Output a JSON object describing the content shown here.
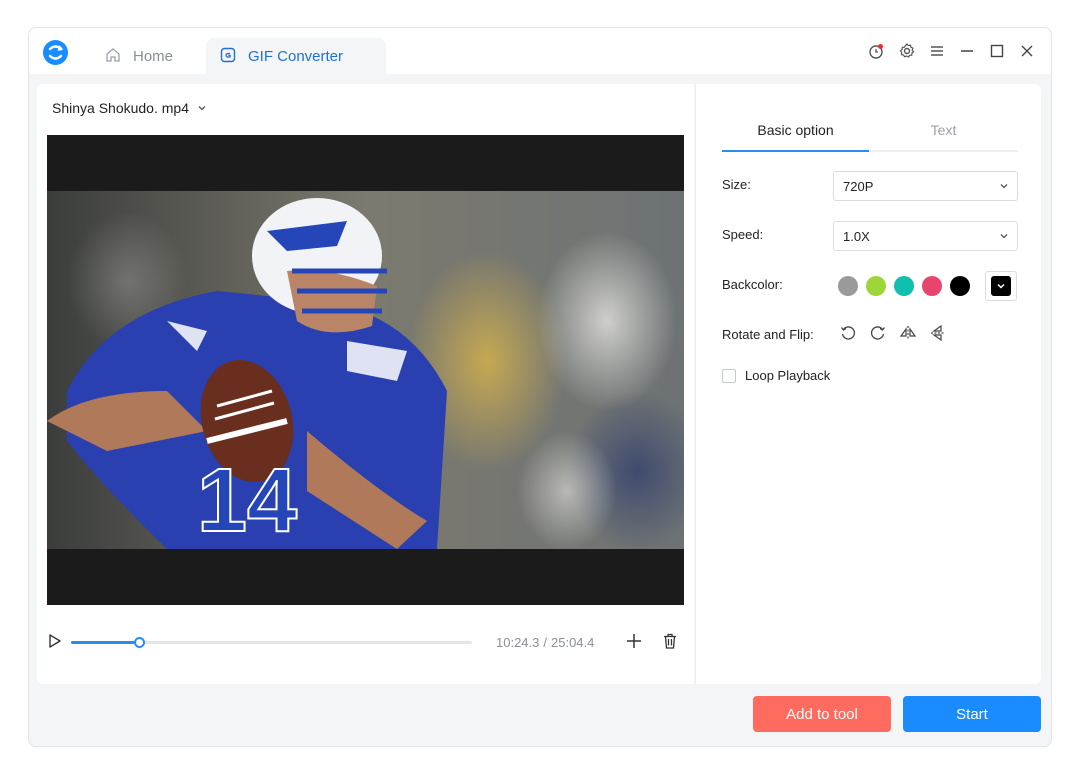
{
  "app": {
    "tabs": [
      {
        "label": "Home",
        "icon": "home-icon"
      },
      {
        "label": "GIF Converter",
        "icon": "gif-icon"
      }
    ],
    "active_tab": "GIF Converter",
    "accent_color": "#1a8cff"
  },
  "player": {
    "file_name": "Shinya Shokudo. mp4",
    "current_time": "10:24.3",
    "separator": "/",
    "total_time": "25:04.4",
    "progress": 0.17
  },
  "options": {
    "tabs": [
      "Basic option",
      "Text"
    ],
    "active_tab": "Basic option",
    "size_label": "Size:",
    "size_value": "720P",
    "speed_label": "Speed:",
    "speed_value": "1.0X",
    "backcolor_label": "Backcolor:",
    "swatches": [
      "#9a9a9a",
      "#9ed63a",
      "#10bfae",
      "#e8456e",
      "#000000"
    ],
    "rotate_label": "Rotate and Flip:",
    "loop_label": "Loop Playback",
    "loop_checked": false
  },
  "footer": {
    "add_label": "Add to tool",
    "start_label": "Start"
  }
}
